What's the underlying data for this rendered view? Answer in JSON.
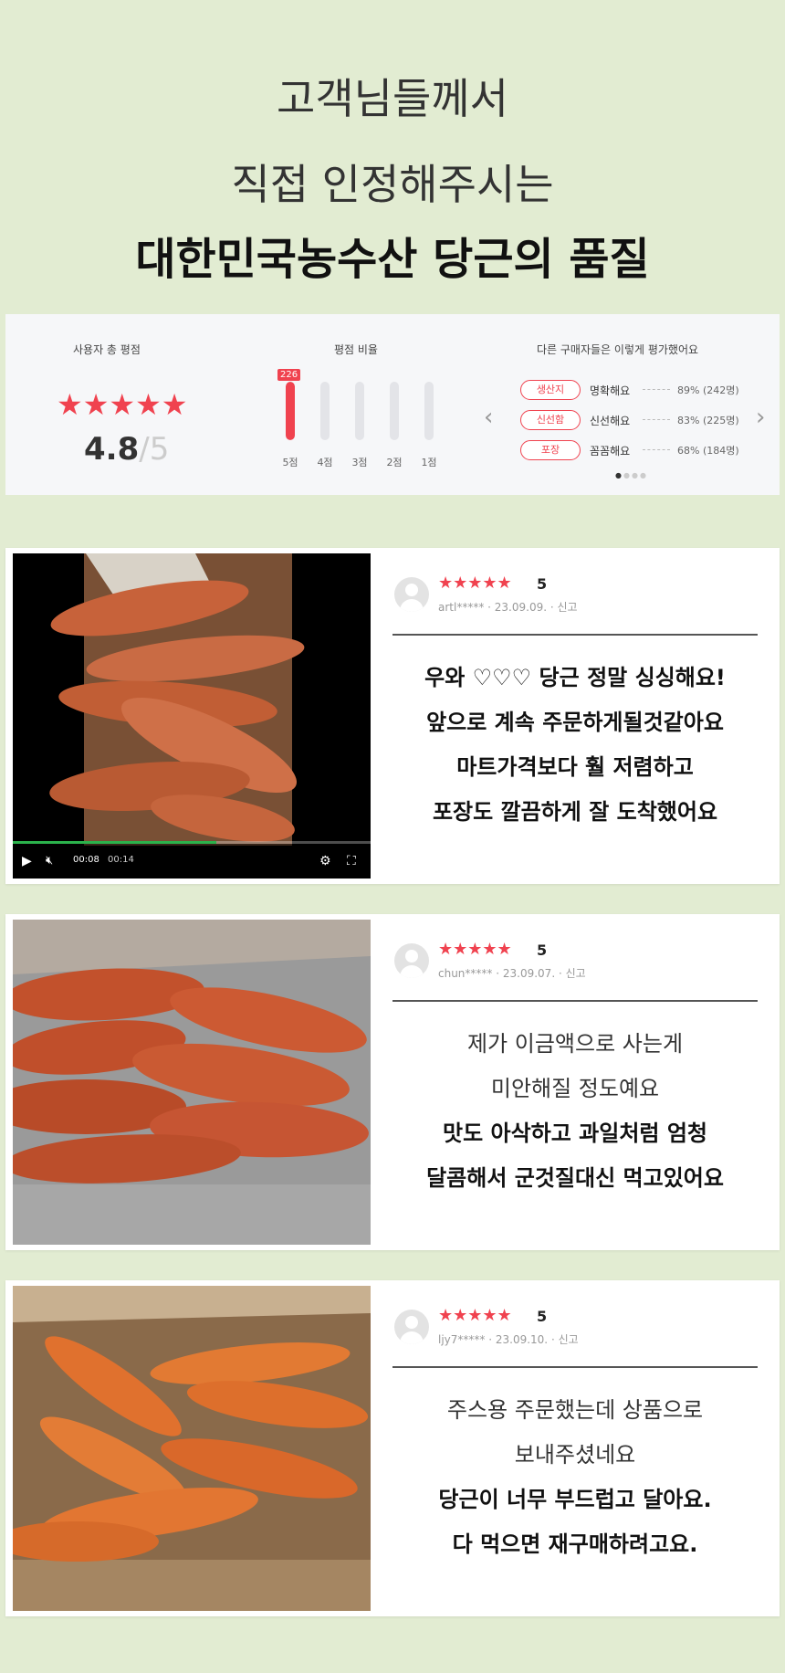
{
  "headline": {
    "line1": "고객님들께서",
    "line2": "직접 인정해주시는",
    "line3": "대한민국농수산 당근의 품질"
  },
  "rating_summary": {
    "title_total": "사용자 총 평점",
    "stars": "★★★★★",
    "score": "4.8",
    "score_suffix": "/5",
    "title_ratio": "평점 비율",
    "bars": [
      {
        "label": "5점",
        "fraction": 1.0,
        "count": "226"
      },
      {
        "label": "4점",
        "fraction": 0.0
      },
      {
        "label": "3점",
        "fraction": 0.0
      },
      {
        "label": "2점",
        "fraction": 0.0
      },
      {
        "label": "1점",
        "fraction": 0.0
      }
    ],
    "title_eval": "다른 구매자들은 이렇게 평가했어요",
    "evaluations": [
      {
        "tag": "생산지",
        "text": "명확해요",
        "pct": "89% (242명)"
      },
      {
        "tag": "신선함",
        "text": "신선해요",
        "pct": "83% (225명)"
      },
      {
        "tag": "포장",
        "text": "꼼꼼해요",
        "pct": "68% (184명)"
      }
    ],
    "prev_arrow": "‹",
    "next_arrow": "›",
    "dots": [
      "●",
      "●",
      "●",
      "●"
    ]
  },
  "reviews": [
    {
      "stars": "★★★★★",
      "score": "5",
      "user": "artl*****",
      "date": "23.09.09.",
      "report": "신고",
      "lines": [
        "우와 ♡♡♡ 당근 정말 싱싱해요!",
        "앞으로 계속 주문하게될것같아요",
        "마트가격보다 훨 저렴하고",
        "포장도 깔끔하게 잘 도착했어요"
      ],
      "video": {
        "time_current": "00:08",
        "time_total": "00:14",
        "progress": 0.57
      }
    },
    {
      "stars": "★★★★★",
      "score": "5",
      "user": "chun*****",
      "date": "23.09.07.",
      "report": "신고",
      "lines": [
        "제가 이금액으로 사는게",
        "미안해질 정도예요",
        "맛도 아삭하고 과일처럼 엄청",
        "달콤해서 군것질대신 먹고있어요"
      ]
    },
    {
      "stars": "★★★★★",
      "score": "5",
      "user": "ljy7*****",
      "date": "23.09.10.",
      "report": "신고",
      "lines": [
        "주스용 주문했는데 상품으로",
        "보내주셨네요",
        "당근이 너무 부드럽고 달아요.",
        "다 먹으면 재구매하려고요."
      ]
    }
  ],
  "colors": {
    "background": "#e2ecd2",
    "accent": "#f0424f",
    "carrot": "#d9602c"
  },
  "icons": {
    "play": "play-icon",
    "mute": "mute-icon",
    "settings": "gear-icon",
    "fullscreen": "fullscreen-icon",
    "avatar": "user-avatar-icon"
  }
}
